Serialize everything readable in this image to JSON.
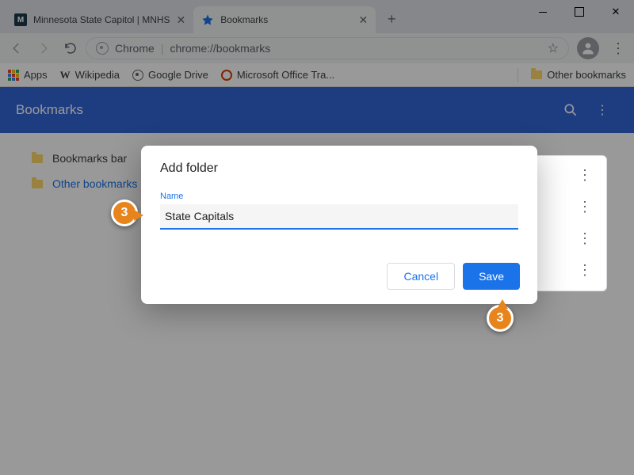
{
  "window": {
    "tabs": [
      {
        "label": "Minnesota State Capitol | MNHS",
        "favicon": "mnhs"
      },
      {
        "label": "Bookmarks",
        "favicon": "star"
      }
    ]
  },
  "toolbar": {
    "chrome_label": "Chrome",
    "url": "chrome://bookmarks"
  },
  "bookmarkbar": {
    "apps": "Apps",
    "items": [
      "Wikipedia",
      "Google Drive",
      "Microsoft Office Tra..."
    ],
    "other": "Other bookmarks"
  },
  "header": {
    "title": "Bookmarks"
  },
  "tree": {
    "items": [
      "Bookmarks bar",
      "Other bookmarks"
    ]
  },
  "dialog": {
    "title": "Add folder",
    "field_label": "Name",
    "field_value": "State Capitals",
    "cancel": "Cancel",
    "save": "Save"
  },
  "callouts": {
    "a": "3",
    "b": "3"
  }
}
